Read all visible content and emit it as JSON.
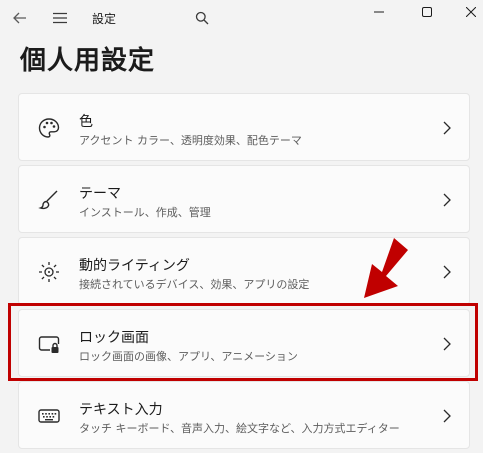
{
  "window": {
    "title": "設定",
    "back_icon": "back-arrow-icon",
    "menu_icon": "hamburger-menu-icon",
    "search_icon": "search-icon",
    "controls": [
      "minimize-icon",
      "maximize-icon",
      "close-icon"
    ]
  },
  "page": {
    "title": "個人用設定"
  },
  "settings": [
    {
      "title": "色",
      "subtitle": "アクセント カラー、透明度効果、配色テーマ",
      "icon": "palette-icon"
    },
    {
      "title": "テーマ",
      "subtitle": "インストール、作成、管理",
      "icon": "brush-icon"
    },
    {
      "title": "動的ライティング",
      "subtitle": "接続されているデバイス、効果、アプリの設定",
      "icon": "lighting-icon"
    },
    {
      "title": "ロック画面",
      "subtitle": "ロック画面の画像、アプリ、アニメーション",
      "icon": "lock-screen-icon"
    },
    {
      "title": "テキスト入力",
      "subtitle": "タッチ キーボード、音声入力、絵文字など、入力方式エディター",
      "icon": "keyboard-icon"
    }
  ],
  "annotation": {
    "highlight_color": "#c00000",
    "arrow_color": "#c00000"
  }
}
